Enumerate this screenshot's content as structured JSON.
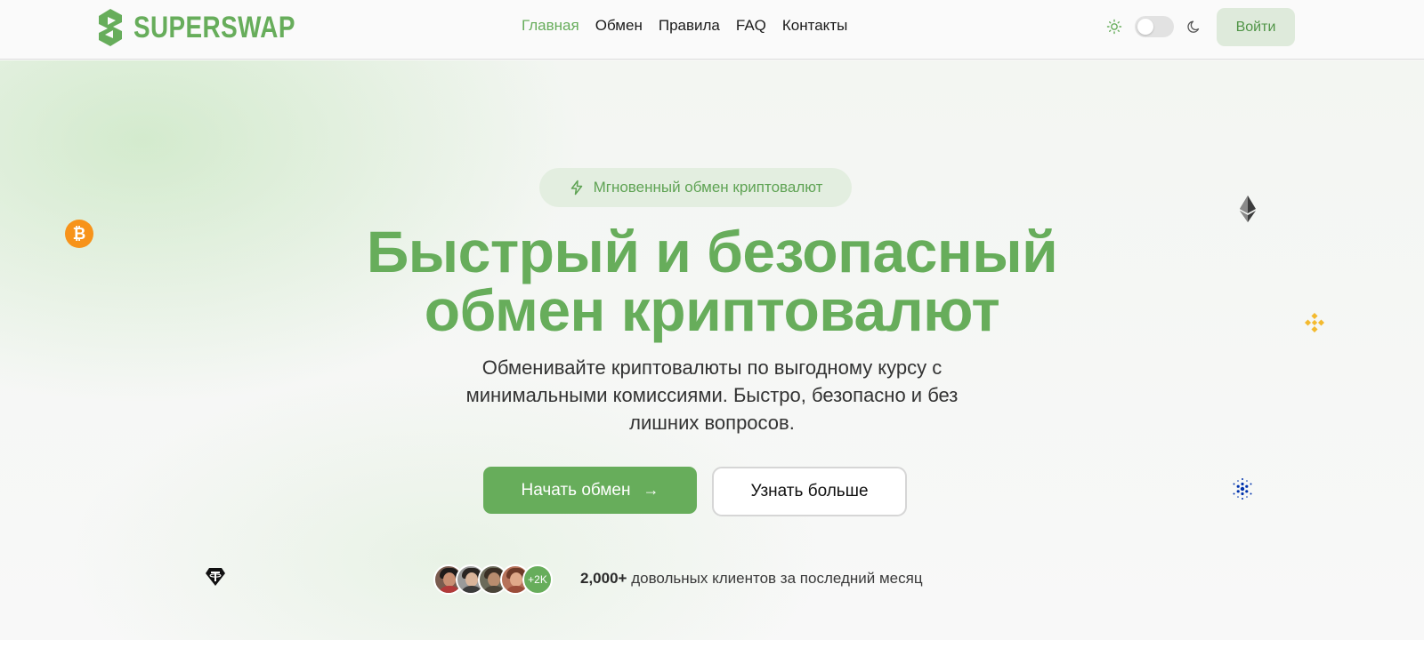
{
  "header": {
    "logo_text": "SUPERSWAP",
    "nav": [
      {
        "label": "Главная",
        "active": true
      },
      {
        "label": "Обмен",
        "active": false
      },
      {
        "label": "Правила",
        "active": false
      },
      {
        "label": "FAQ",
        "active": false
      },
      {
        "label": "Контакты",
        "active": false
      }
    ],
    "theme_toggle": {
      "sun_icon": "sun-icon",
      "moon_icon": "moon-icon",
      "state": "light"
    },
    "login_label": "Войти"
  },
  "hero": {
    "badge_icon": "lightning-icon",
    "badge_text": "Мгновенный обмен криптовалют",
    "title_line1": "Быстрый и безопасный",
    "title_line2": "обмен криптовалют",
    "subtitle_line1": "Обменивайте криптовалюты по выгодному курсу с",
    "subtitle_line2": "минимальными комиссиями. Быстро, безопасно и без",
    "subtitle_line3": "лишних вопросов.",
    "primary_button": "Начать обмен",
    "primary_button_icon": "arrow-right-icon",
    "secondary_button": "Узнать больше",
    "avatars_more": "+2K",
    "clients_count": "2,000+",
    "clients_text": "довольных клиентов за последний месяц"
  },
  "floating_coins": [
    {
      "name": "bitcoin-icon",
      "color": "#f7931a"
    },
    {
      "name": "ethereum-icon",
      "color": "#3c3c3d"
    },
    {
      "name": "binance-icon",
      "color": "#f3ba2f"
    },
    {
      "name": "cardano-icon",
      "color": "#0033ad"
    },
    {
      "name": "tether-icon",
      "color": "#111111"
    }
  ],
  "colors": {
    "accent": "#67ad5b",
    "accent_light": "#deeadb"
  }
}
